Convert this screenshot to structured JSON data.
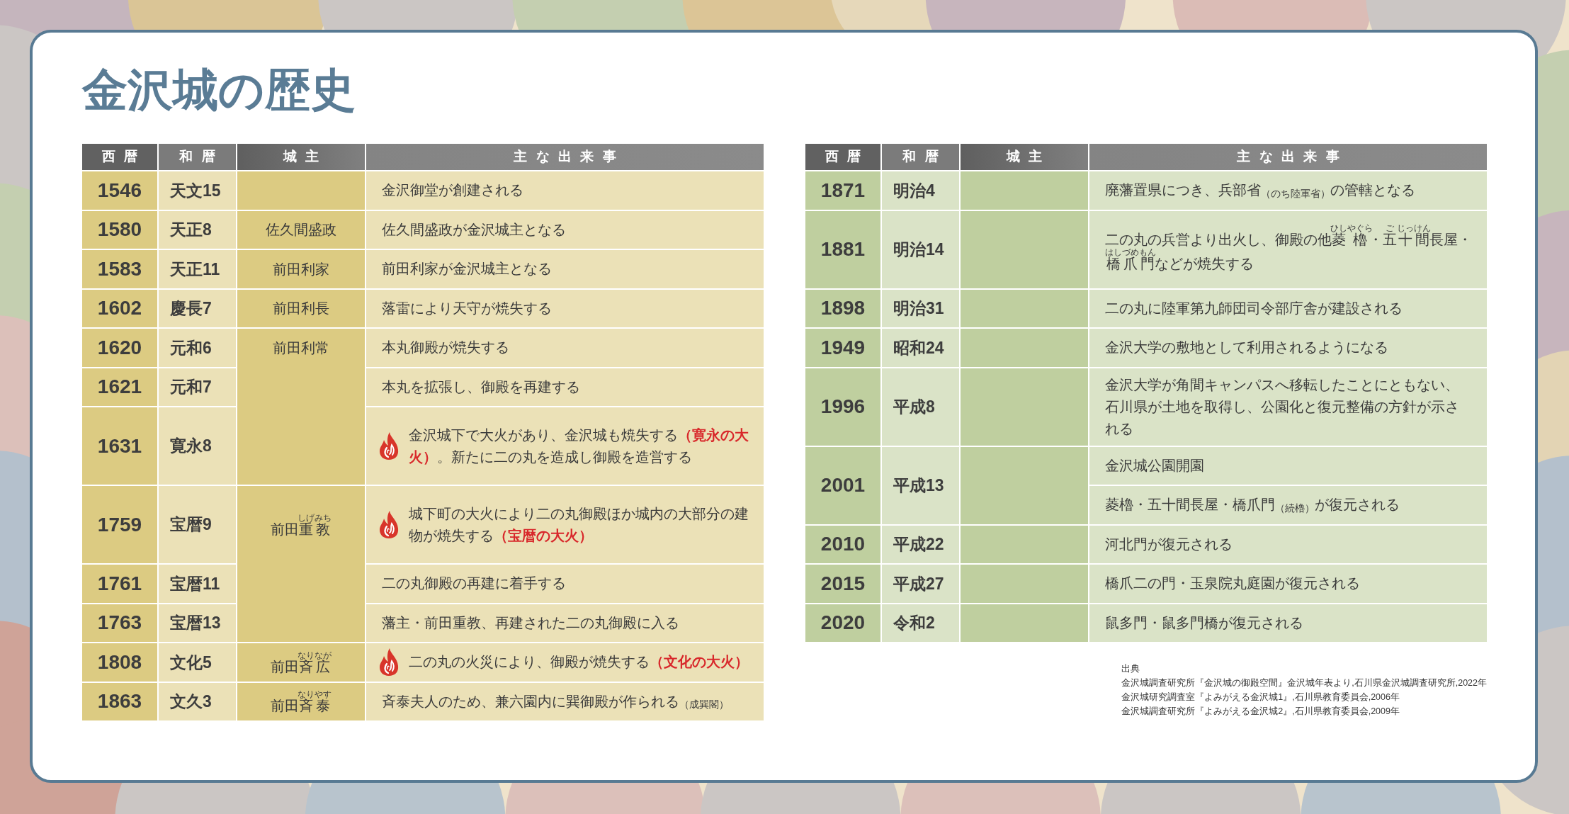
{
  "title": "金沢城の歴史",
  "tables": [
    {
      "color": "#dccb82",
      "columns": [
        "西暦",
        "和暦",
        "城主",
        "主な出来事"
      ],
      "groups": [
        {
          "rows": [
            {
              "year": "1546",
              "era": "天文15",
              "events": [
                {
                  "text": "金沢御堂が創建される",
                  "fire": false
                }
              ]
            }
          ]
        },
        {
          "castellan": {
            "name": "佐久間盛政"
          },
          "rows": [
            {
              "year": "1580",
              "era": "天正8",
              "events": [
                {
                  "text": "佐久間盛政が金沢城主となる",
                  "fire": false
                }
              ]
            }
          ]
        },
        {
          "castellan": {
            "name": "前田利家"
          },
          "rows": [
            {
              "year": "1583",
              "era": "天正11",
              "events": [
                {
                  "text": "前田利家が金沢城主となる",
                  "fire": false
                }
              ]
            }
          ]
        },
        {
          "castellan": {
            "name": "前田利長"
          },
          "rows": [
            {
              "year": "1602",
              "era": "慶長7",
              "events": [
                {
                  "text": "落雷により天守が焼失する",
                  "fire": false
                }
              ]
            }
          ]
        },
        {
          "castellan": {
            "name": "前田利常"
          },
          "rows": [
            {
              "year": "1620",
              "era": "元和6",
              "events": [
                {
                  "text": "本丸御殿が焼失する",
                  "fire": false
                }
              ]
            },
            {
              "year": "1621",
              "era": "元和7",
              "events": [
                {
                  "text": "本丸を拡張し、御殿を再建する",
                  "fire": false
                }
              ]
            },
            {
              "year": "1631",
              "era": "寛永8",
              "events": [
                {
                  "text": "金沢城下で大火があり、金沢城も焼失する**（寛永の大火）**。新たに二の丸を造成し御殿を造営する",
                  "fire": true
                }
              ]
            }
          ]
        },
        {
          "castellan": {
            "parts": [
              {
                "text": "前田"
              },
              {
                "text": "重",
                "reading": "しげ"
              },
              {
                "text": "教",
                "reading": "みち"
              }
            ]
          },
          "rows": [
            {
              "year": "1759",
              "era": "宝暦9",
              "events": [
                {
                  "text": "城下町の大火により二の丸御殿ほか城内の大部分の建物が焼失する**（宝暦の大火）**",
                  "fire": true
                }
              ]
            },
            {
              "year": "1761",
              "era": "宝暦11",
              "events": [
                {
                  "text": "二の丸御殿の再建に着手する",
                  "fire": false
                }
              ]
            },
            {
              "year": "1763",
              "era": "宝暦13",
              "events": [
                {
                  "text": "藩主・前田重教、再建された二の丸御殿に入る",
                  "fire": false
                }
              ]
            }
          ]
        },
        {
          "castellan": {
            "parts": [
              {
                "text": "前田"
              },
              {
                "text": "斉",
                "reading": "なり"
              },
              {
                "text": "広",
                "reading": "なが"
              }
            ]
          },
          "rows": [
            {
              "year": "1808",
              "era": "文化5",
              "events": [
                {
                  "text": "二の丸の火災により、御殿が焼失する**（文化の大火）**",
                  "fire": true
                }
              ]
            }
          ]
        },
        {
          "castellan": {
            "parts": [
              {
                "text": "前田"
              },
              {
                "text": "斉",
                "reading": "なり"
              },
              {
                "text": "泰",
                "reading": "やす"
              }
            ]
          },
          "rows": [
            {
              "year": "1863",
              "era": "文久3",
              "events": [
                {
                  "text": "斉泰夫人のため、兼六園内に巽御殿が作られる$_{（成巽閣）}$",
                  "fire": false
                }
              ]
            }
          ]
        }
      ]
    },
    {
      "color": "#bfcf9f",
      "columns": [
        "西暦",
        "和暦",
        "城主",
        "主な出来事"
      ],
      "groups": [
        {
          "rows": [
            {
              "year": "1871",
              "era": "明治4",
              "events": [
                {
                  "text": "廃藩置県につき、兵部省$_{（のち陸軍省）}$の管轄となる",
                  "fire": false
                }
              ]
            }
          ]
        },
        {
          "rows": [
            {
              "year": "1881",
              "era": "明治14",
              "events": [
                {
                  "fire": false,
                  "parts": [
                    {
                      "text": "二の丸の兵営より出火し、御殿の他"
                    },
                    {
                      "text": "菱",
                      "reading": "ひし"
                    },
                    {
                      "text": "櫓",
                      "reading": "やぐら"
                    },
                    {
                      "text": "・"
                    },
                    {
                      "text": "五",
                      "reading": "ご"
                    },
                    {
                      "text": "十",
                      "reading": "じっ"
                    },
                    {
                      "text": "間",
                      "reading": "けん"
                    },
                    {
                      "text": "長屋・"
                    },
                    {
                      "text": "橋",
                      "reading": "はし"
                    },
                    {
                      "text": "爪",
                      "reading": "づめ"
                    },
                    {
                      "text": "門",
                      "reading": "もん"
                    },
                    {
                      "text": "などが焼失する"
                    }
                  ]
                }
              ]
            }
          ]
        },
        {
          "rows": [
            {
              "year": "1898",
              "era": "明治31",
              "events": [
                {
                  "text": "二の丸に陸軍第九師団司令部庁舎が建設される",
                  "fire": false
                }
              ]
            }
          ]
        },
        {
          "rows": [
            {
              "year": "1949",
              "era": "昭和24",
              "events": [
                {
                  "text": "金沢大学の敷地として利用されるようになる",
                  "fire": false
                }
              ]
            }
          ]
        },
        {
          "rows": [
            {
              "year": "1996",
              "era": "平成8",
              "events": [
                {
                  "text": "金沢大学が角間キャンパスへ移転したことにともない、石川県が土地を取得し、公園化と復元整備の方針が示される",
                  "fire": false
                }
              ]
            }
          ]
        },
        {
          "rows": [
            {
              "year": "2001",
              "era": "平成13",
              "events": [
                {
                  "text": "金沢城公園開園",
                  "fire": false
                },
                {
                  "text": "菱櫓・五十間長屋・橋爪門$_{（続櫓）}$が復元される",
                  "fire": false
                }
              ]
            }
          ]
        },
        {
          "rows": [
            {
              "year": "2010",
              "era": "平成22",
              "events": [
                {
                  "text": "河北門が復元される",
                  "fire": false
                }
              ]
            }
          ]
        },
        {
          "rows": [
            {
              "year": "2015",
              "era": "平成27",
              "events": [
                {
                  "text": "橋爪二の門・玉泉院丸庭園が復元される",
                  "fire": false
                }
              ]
            }
          ]
        },
        {
          "rows": [
            {
              "year": "2020",
              "era": "令和2",
              "events": [
                {
                  "text": "鼠多門・鼠多門橋が復元される",
                  "fire": false
                }
              ]
            }
          ]
        }
      ]
    }
  ],
  "sources": {
    "heading": "出典",
    "items": [
      "金沢城調査研究所『金沢城の御殿空間』金沢城年表より,石川県金沢城調査研究所,2022年",
      "金沢城研究調査室『よみがえる金沢城1』,石川県教育委員会,2006年",
      "金沢城調査研究所『よみがえる金沢城2』,石川県教育委員会,2009年"
    ]
  }
}
